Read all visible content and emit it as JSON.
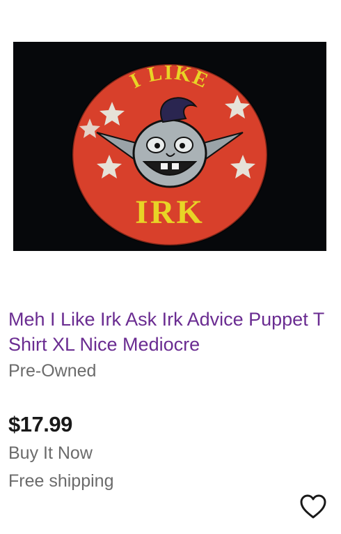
{
  "listing": {
    "image_text_top": "I LIKE",
    "image_text_bottom": "IRK",
    "title": "Meh I Like Irk Ask Irk Advice Puppet T Shirt XL Nice Mediocre",
    "condition": "Pre-Owned",
    "price": "$17.99",
    "format": "Buy It Now",
    "shipping": "Free shipping",
    "watch_icon": "heart-icon"
  },
  "colors": {
    "title": "#6a2c91",
    "secondary_text": "#6b6b6b",
    "price": "#191919",
    "shirt_background": "#06080b",
    "logo_red": "#d8402b",
    "logo_yellow": "#e8d426"
  }
}
